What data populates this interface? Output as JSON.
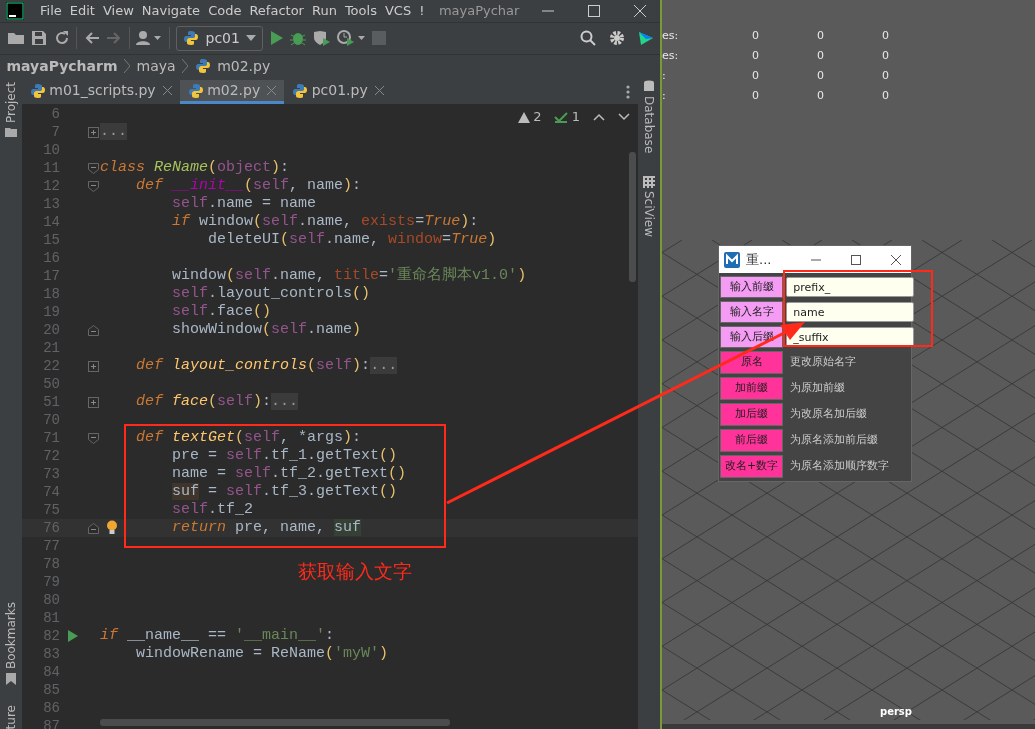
{
  "ide": {
    "menu": [
      "File",
      "Edit",
      "View",
      "Navigate",
      "Code",
      "Refactor",
      "Run",
      "Tools",
      "VCS",
      "!"
    ],
    "window_title": "mayaPychar",
    "run_config": "pc01",
    "breadcrumb": [
      "mayaPycharm",
      "maya",
      "m02.py"
    ],
    "tabs": [
      {
        "label": "m01_scripts.py",
        "selected": false
      },
      {
        "label": "m02.py",
        "selected": true
      },
      {
        "label": "pc01.py",
        "selected": false
      }
    ],
    "left_strip": [
      "Project",
      "Bookmarks",
      "ture"
    ],
    "right_strip": [
      "Database",
      "SciView"
    ],
    "inspections": {
      "warnings": "2",
      "weak_warnings": "1"
    },
    "lines": [
      {
        "number": "6"
      },
      {
        "number": "7",
        "collapsed": true,
        "tokens": [
          {
            "text": "...",
            "kind": "fold"
          }
        ]
      },
      {
        "number": "10"
      },
      {
        "number": "11",
        "fold_start": true,
        "tokens": [
          {
            "text": "class ",
            "kind": "kw"
          },
          {
            "text": "ReName",
            "kind": "cls"
          },
          {
            "text": "(",
            "kind": "paren"
          },
          {
            "text": "object",
            "kind": "self"
          },
          {
            "text": ")",
            "kind": "paren"
          },
          {
            "text": ":",
            "kind": "plain"
          }
        ]
      },
      {
        "number": "12",
        "fold_start": true,
        "tokens": [
          {
            "text": "    def ",
            "kind": "kw"
          },
          {
            "text": "__init__",
            "kind": "magic"
          },
          {
            "text": "(",
            "kind": "paren"
          },
          {
            "text": "self",
            "kind": "self"
          },
          {
            "text": ", name",
            "kind": "plain"
          },
          {
            "text": ")",
            "kind": "paren"
          },
          {
            "text": ":",
            "kind": "plain"
          }
        ]
      },
      {
        "number": "13",
        "tokens": [
          {
            "text": "        self",
            "kind": "self"
          },
          {
            "text": ".name = name",
            "kind": "plain"
          }
        ]
      },
      {
        "number": "14",
        "tokens": [
          {
            "text": "        if",
            "kind": "kw"
          },
          {
            "text": " window",
            "kind": "plain"
          },
          {
            "text": "(",
            "kind": "paren"
          },
          {
            "text": "self",
            "kind": "self"
          },
          {
            "text": ".name, ",
            "kind": "plain"
          },
          {
            "text": "exists",
            "kind": "arg"
          },
          {
            "text": "=",
            "kind": "plain"
          },
          {
            "text": "True",
            "kind": "bool"
          },
          {
            "text": ")",
            "kind": "paren"
          },
          {
            "text": ":",
            "kind": "plain"
          }
        ]
      },
      {
        "number": "15",
        "tokens": [
          {
            "text": "            deleteUI",
            "kind": "plain"
          },
          {
            "text": "(",
            "kind": "paren"
          },
          {
            "text": "self",
            "kind": "self"
          },
          {
            "text": ".name, ",
            "kind": "plain"
          },
          {
            "text": "window",
            "kind": "arg"
          },
          {
            "text": "=",
            "kind": "plain"
          },
          {
            "text": "True",
            "kind": "bool"
          },
          {
            "text": ")",
            "kind": "paren"
          }
        ]
      },
      {
        "number": "16"
      },
      {
        "number": "17",
        "tokens": [
          {
            "text": "        window",
            "kind": "plain"
          },
          {
            "text": "(",
            "kind": "paren"
          },
          {
            "text": "self",
            "kind": "self"
          },
          {
            "text": ".name, ",
            "kind": "plain"
          },
          {
            "text": "title",
            "kind": "arg"
          },
          {
            "text": "=",
            "kind": "plain"
          },
          {
            "text": "'重命名脚本v1.0'",
            "kind": "str"
          },
          {
            "text": ")",
            "kind": "paren"
          }
        ]
      },
      {
        "number": "18",
        "tokens": [
          {
            "text": "        self",
            "kind": "self"
          },
          {
            "text": ".layout_controls",
            "kind": "plain"
          },
          {
            "text": "()",
            "kind": "paren"
          }
        ]
      },
      {
        "number": "19",
        "tokens": [
          {
            "text": "        self",
            "kind": "self"
          },
          {
            "text": ".face",
            "kind": "plain"
          },
          {
            "text": "()",
            "kind": "paren"
          }
        ]
      },
      {
        "number": "20",
        "fold_end": true,
        "tokens": [
          {
            "text": "        showWindow",
            "kind": "plain"
          },
          {
            "text": "(",
            "kind": "paren"
          },
          {
            "text": "self",
            "kind": "self"
          },
          {
            "text": ".name",
            "kind": "plain"
          },
          {
            "text": ")",
            "kind": "paren"
          }
        ]
      },
      {
        "number": "21"
      },
      {
        "number": "22",
        "collapsed": true,
        "tokens": [
          {
            "text": "    def ",
            "kind": "kw"
          },
          {
            "text": "layout_controls",
            "kind": "fn"
          },
          {
            "text": "(",
            "kind": "paren"
          },
          {
            "text": "self",
            "kind": "self"
          },
          {
            "text": ")",
            "kind": "paren"
          },
          {
            "text": ":",
            "kind": "plain"
          },
          {
            "text": "...",
            "kind": "fold"
          }
        ]
      },
      {
        "number": "50"
      },
      {
        "number": "51",
        "collapsed": true,
        "tokens": [
          {
            "text": "    def ",
            "kind": "kw"
          },
          {
            "text": "face",
            "kind": "fn"
          },
          {
            "text": "(",
            "kind": "paren"
          },
          {
            "text": "self",
            "kind": "self"
          },
          {
            "text": ")",
            "kind": "paren"
          },
          {
            "text": ":",
            "kind": "plain"
          },
          {
            "text": "...",
            "kind": "fold"
          }
        ]
      },
      {
        "number": "70"
      },
      {
        "number": "71",
        "fold_start": true,
        "tokens": [
          {
            "text": "    def ",
            "kind": "kw"
          },
          {
            "text": "textGet",
            "kind": "fn"
          },
          {
            "text": "(",
            "kind": "paren"
          },
          {
            "text": "self",
            "kind": "self"
          },
          {
            "text": ", *args",
            "kind": "plain"
          },
          {
            "text": ")",
            "kind": "paren"
          },
          {
            "text": ":",
            "kind": "plain"
          }
        ]
      },
      {
        "number": "72",
        "tokens": [
          {
            "text": "        pre = ",
            "kind": "plain"
          },
          {
            "text": "self",
            "kind": "self"
          },
          {
            "text": ".tf_1.getText",
            "kind": "plain"
          },
          {
            "text": "()",
            "kind": "paren"
          }
        ]
      },
      {
        "number": "73",
        "tokens": [
          {
            "text": "        name = ",
            "kind": "plain"
          },
          {
            "text": "self",
            "kind": "self"
          },
          {
            "text": ".tf_2.getText",
            "kind": "plain"
          },
          {
            "text": "()",
            "kind": "paren"
          }
        ]
      },
      {
        "number": "74",
        "tokens": [
          {
            "text": "        suf",
            "kind": "hlw"
          },
          {
            "text": " = ",
            "kind": "plain"
          },
          {
            "text": "self",
            "kind": "self"
          },
          {
            "text": ".tf_3.getText",
            "kind": "plain"
          },
          {
            "text": "()",
            "kind": "paren"
          }
        ]
      },
      {
        "number": "75",
        "tokens": [
          {
            "text": "        self",
            "kind": "self"
          },
          {
            "text": ".tf_2",
            "kind": "plain"
          }
        ]
      },
      {
        "number": "76",
        "fold_end": true,
        "current": true,
        "bulb": true,
        "tokens": [
          {
            "text": "        return",
            "kind": "kw"
          },
          {
            "text": " pre, name, ",
            "kind": "plain"
          },
          {
            "text": "suf",
            "kind": "hlr"
          }
        ]
      },
      {
        "number": "77"
      },
      {
        "number": "78"
      },
      {
        "number": "79"
      },
      {
        "number": "80"
      },
      {
        "number": "81"
      },
      {
        "number": "82",
        "runnable": true,
        "tokens": [
          {
            "text": "if",
            "kind": "kw"
          },
          {
            "text": " __name__ == ",
            "kind": "plain"
          },
          {
            "text": "'__main__'",
            "kind": "str"
          },
          {
            "text": ":",
            "kind": "plain"
          }
        ]
      },
      {
        "number": "83",
        "tokens": [
          {
            "text": "    windowRename = ReName",
            "kind": "plain"
          },
          {
            "text": "(",
            "kind": "paren"
          },
          {
            "text": "'myW'",
            "kind": "str"
          },
          {
            "text": ")",
            "kind": "paren"
          }
        ]
      },
      {
        "number": "84"
      },
      {
        "number": "85"
      },
      {
        "number": "86"
      },
      {
        "number": "87"
      }
    ]
  },
  "viewport": {
    "stats": [
      {
        "label": "es:",
        "values": [
          "0",
          "0",
          "0"
        ]
      },
      {
        "label": "es:",
        "values": [
          "0",
          "0",
          "0"
        ]
      },
      {
        "label": ":",
        "values": [
          "0",
          "0",
          "0"
        ]
      },
      {
        "label": ":",
        "values": [
          "0",
          "0",
          "0"
        ]
      }
    ],
    "camera": "persp"
  },
  "dialog": {
    "title": "重...",
    "fields": [
      {
        "label": "输入前缀",
        "value": "prefix_"
      },
      {
        "label": "输入名字",
        "value": "name"
      },
      {
        "label": "输入后缀",
        "value": "_suffix"
      }
    ],
    "actions": [
      {
        "label": "原名",
        "description": "更改原始名字"
      },
      {
        "label": "加前缀",
        "description": "为原加前缀"
      },
      {
        "label": "加后缀",
        "description": "为改原名加后缀"
      },
      {
        "label": "前后缀",
        "description": "为原名添加前后缀"
      },
      {
        "label": "改名+数字",
        "description": "为原名添加顺序数字"
      }
    ]
  },
  "annotation": {
    "caption": "获取输入文字"
  }
}
